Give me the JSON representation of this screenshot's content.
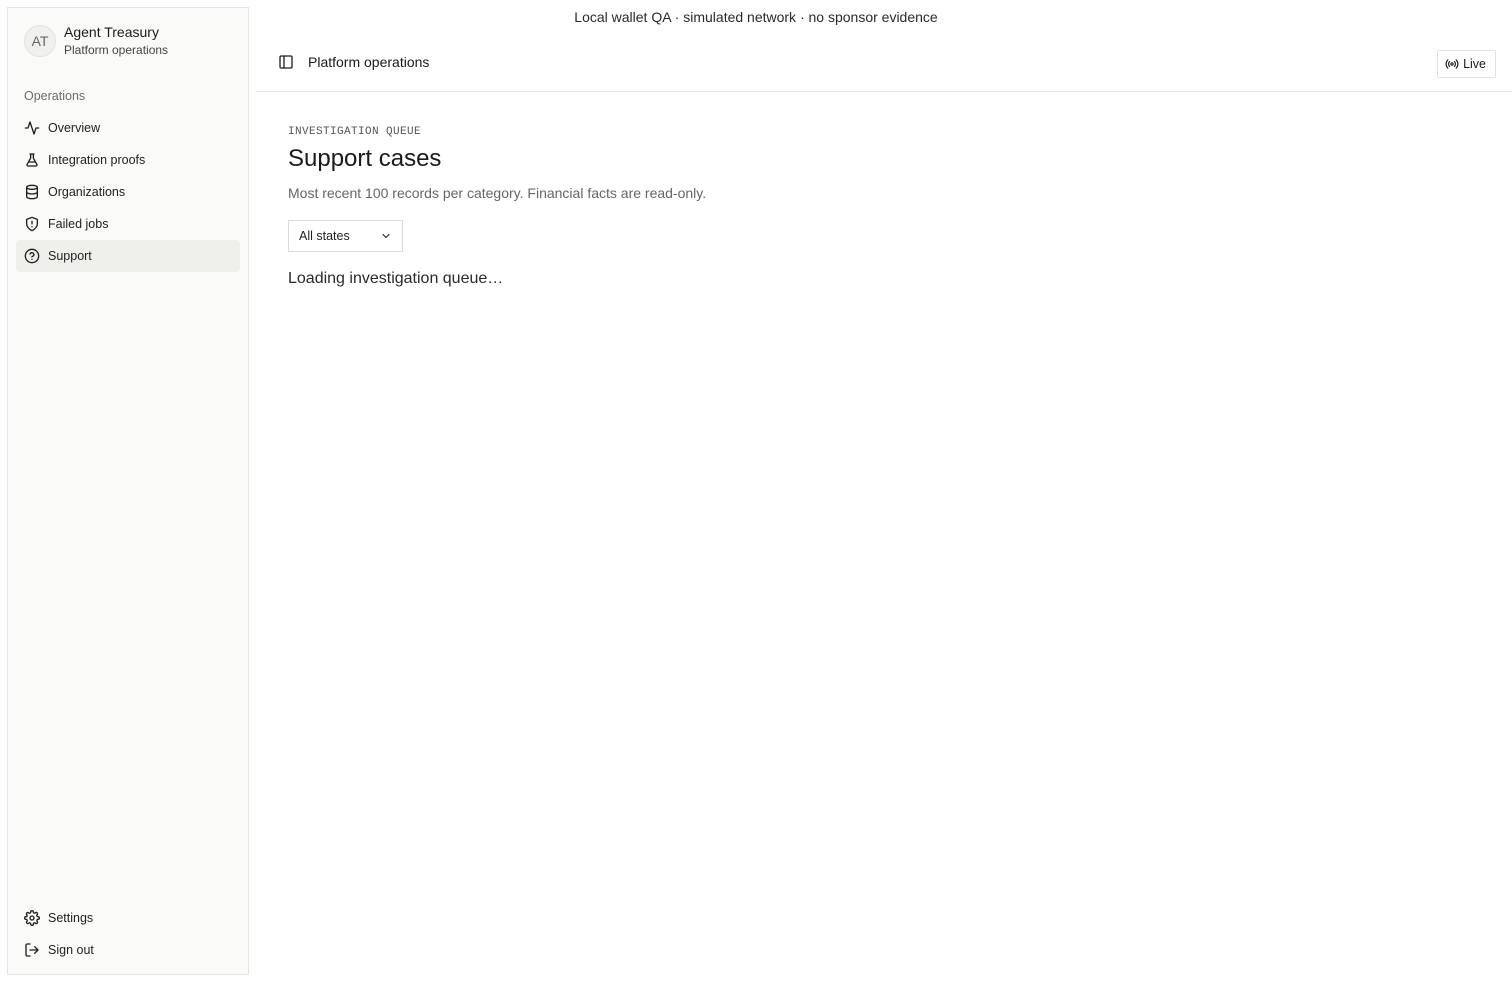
{
  "banner": {
    "text": "Local wallet QA · simulated network · no sponsor evidence"
  },
  "sidebar": {
    "brand": {
      "initials": "AT",
      "name": "Agent Treasury",
      "subtitle": "Platform operations"
    },
    "group_label": "Operations",
    "items": [
      {
        "label": "Overview",
        "icon": "activity-icon"
      },
      {
        "label": "Integration proofs",
        "icon": "flask-icon"
      },
      {
        "label": "Organizations",
        "icon": "database-icon"
      },
      {
        "label": "Failed jobs",
        "icon": "shield-alert-icon"
      },
      {
        "label": "Support",
        "icon": "help-circle-icon",
        "active": true
      }
    ],
    "bottom_items": [
      {
        "label": "Settings",
        "icon": "gear-icon"
      },
      {
        "label": "Sign out",
        "icon": "sign-out-icon"
      }
    ]
  },
  "topbar": {
    "title": "Platform operations",
    "live_label": "Live"
  },
  "main": {
    "eyebrow": "INVESTIGATION QUEUE",
    "title": "Support cases",
    "description": "Most recent 100 records per category. Financial facts are read-only.",
    "filter": {
      "selected": "All states"
    },
    "loading_text": "Loading investigation queue…"
  }
}
